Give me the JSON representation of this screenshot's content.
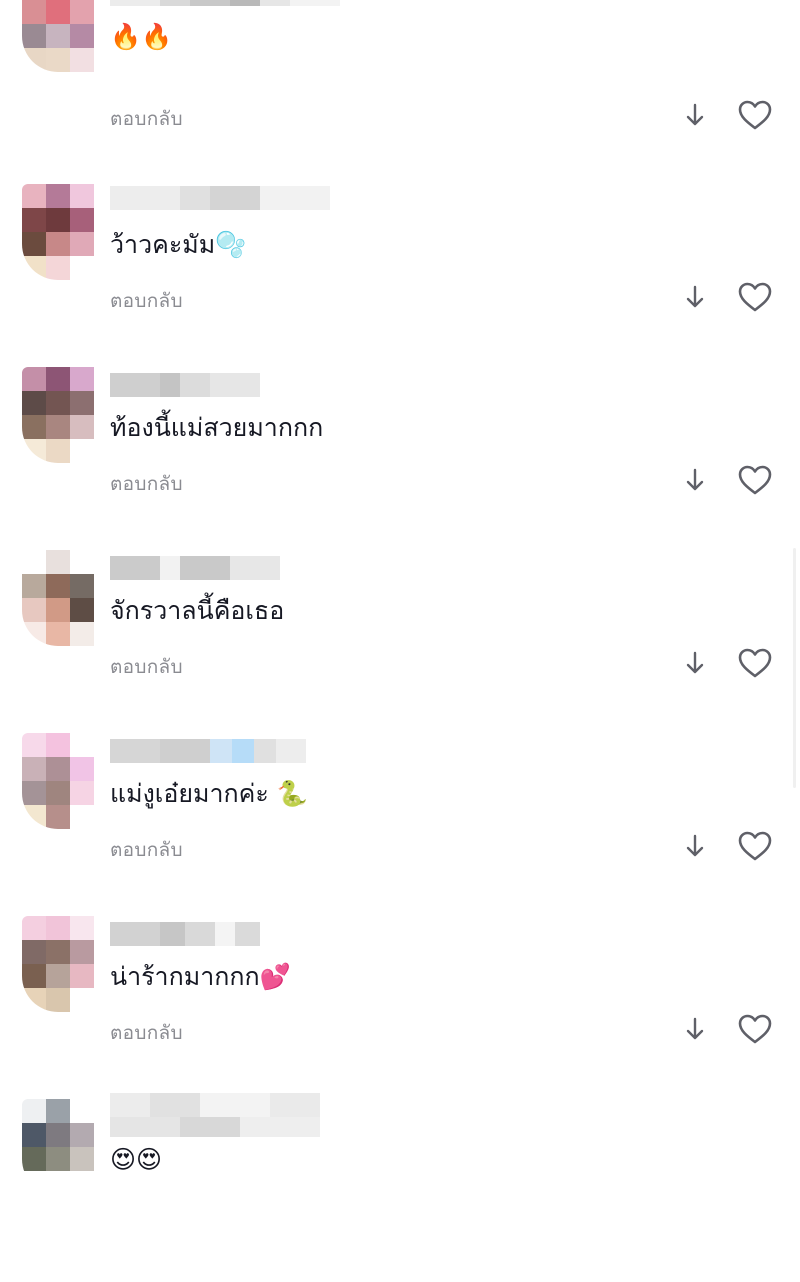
{
  "comments": [
    {
      "text": "🔥🔥",
      "reply_label": "ตอบกลับ"
    },
    {
      "text": "ว้าวคะมัม🫧",
      "reply_label": "ตอบกลับ"
    },
    {
      "text": "ท้องนี้แม่สวยมากกก",
      "reply_label": "ตอบกลับ"
    },
    {
      "text": "จักรวาลนี้คือเธอ",
      "reply_label": "ตอบกลับ"
    },
    {
      "text": "แม่งูเอ๋ยมากค่ะ 🐍",
      "reply_label": "ตอบกลับ"
    },
    {
      "text": "น่าร้ากมากกก💕",
      "reply_label": "ตอบกลับ"
    },
    {
      "text": "😍😍",
      "reply_label": ""
    }
  ],
  "icons": {
    "dislike": "arrow-down-icon",
    "like": "heart-outline-icon"
  },
  "colors": {
    "text": "#161823",
    "secondary": "#8a8b91",
    "icon": "#5f6068"
  }
}
